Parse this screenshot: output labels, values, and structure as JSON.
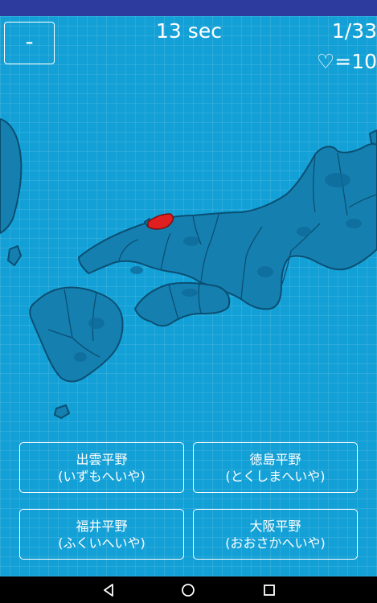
{
  "header": {
    "menu_label": "-",
    "timer": "13 sec",
    "progress": "1/33",
    "lives": "♡=10"
  },
  "answers": [
    {
      "name": "出雲平野",
      "reading": "(いずもへいや)"
    },
    {
      "name": "徳島平野",
      "reading": "(とくしまへいや)"
    },
    {
      "name": "福井平野",
      "reading": "(ふくいへいや)"
    },
    {
      "name": "大阪平野",
      "reading": "(おおさかへいや)"
    }
  ],
  "colors": {
    "sea": "#13a0d6",
    "land": "#1580b0",
    "border": "#0b4f73",
    "highlight": "#e02020",
    "status_bar": "#2d3a9e",
    "nav_bar": "#000000"
  },
  "icons": {
    "back": "back-triangle-icon",
    "home": "home-circle-icon",
    "recents": "recents-square-icon"
  }
}
